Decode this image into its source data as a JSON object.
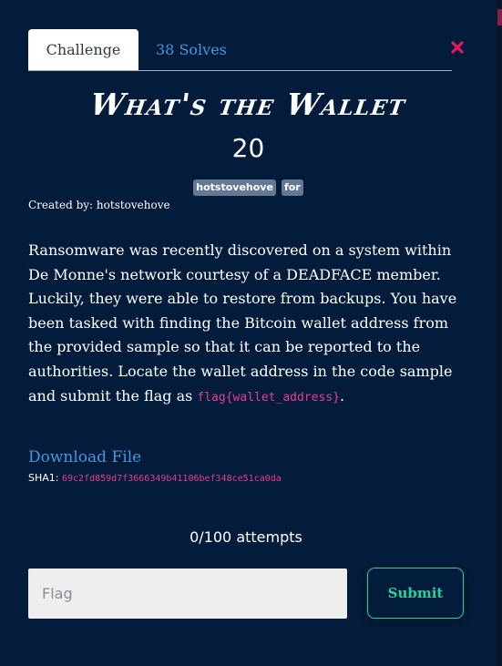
{
  "tabs": {
    "challenge_label": "Challenge",
    "solves_label": "38 Solves"
  },
  "close_icon": "close-x-icon",
  "challenge": {
    "name": "What's the Wallet",
    "points": "20",
    "tags": [
      "hotstovehove",
      "for"
    ],
    "author": "Created by: hotstovehove",
    "description_text": "Ransomware was recently discovered on a system within De Monne's network courtesy of a DEADFACE member. Luckily, they were able to restore from backups. You have been tasked with finding the Bitcoin wallet address from the provided sample so that it can be reported to the authorities. Locate the wallet address in the code sample and submit the flag as ",
    "flag_format": "flag{wallet_address}",
    "description_end": "."
  },
  "file": {
    "download_label": "Download File",
    "sha_label": "SHA1:",
    "sha_value": "69c2fd859d7f3666349b41106bef348ce51ca0da"
  },
  "attempts": "0/100 attempts",
  "form": {
    "placeholder": "Flag",
    "submit_label": "Submit"
  },
  "colors": {
    "background": "#031c3b",
    "accent": "#21d3a3",
    "link": "#4a95dc",
    "code": "#e83e8c",
    "tag": "#657894",
    "close": "#e8175d"
  }
}
